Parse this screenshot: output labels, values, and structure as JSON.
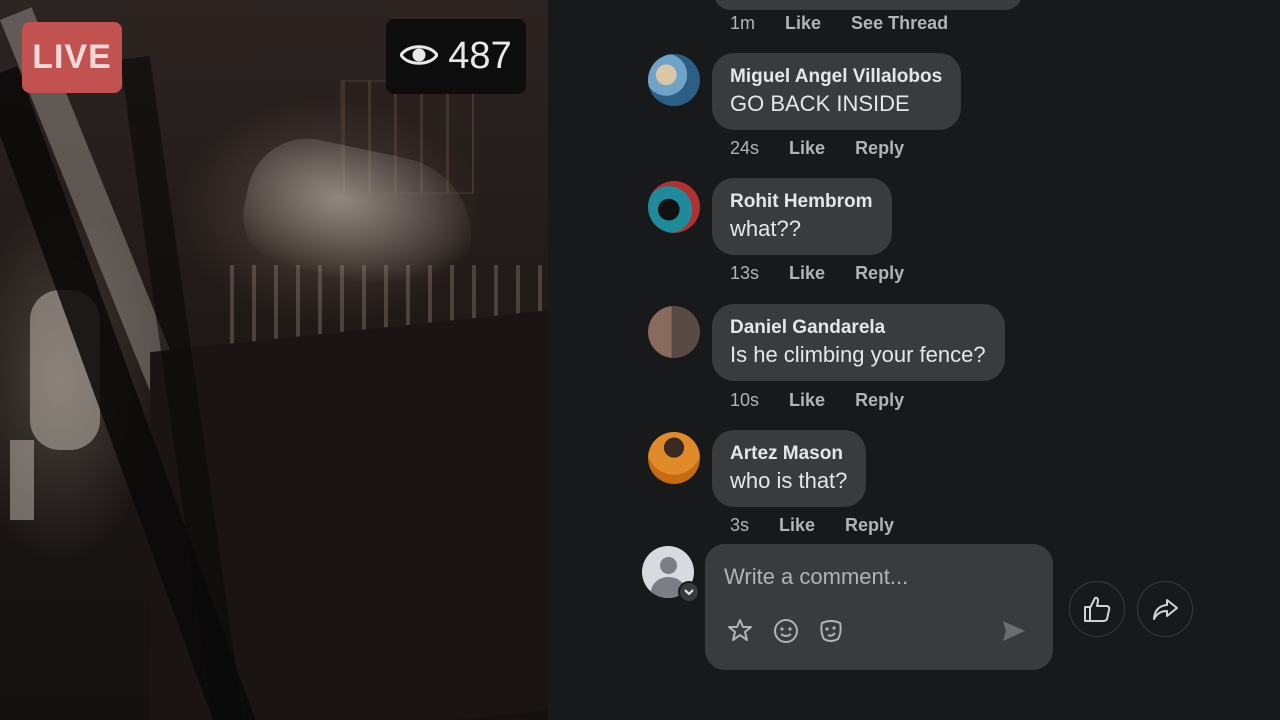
{
  "video": {
    "live_label": "LIVE",
    "viewer_icon": "eye-icon",
    "viewer_count": "487"
  },
  "previous_comment": {
    "time": "1m",
    "like": "Like",
    "action": "See Thread"
  },
  "comments": [
    {
      "name": "Miguel Angel Villalobos",
      "text": "GO BACK INSIDE",
      "time": "24s",
      "like": "Like",
      "reply": "Reply"
    },
    {
      "name": "Rohit Hembrom",
      "text": "what??",
      "time": "13s",
      "like": "Like",
      "reply": "Reply"
    },
    {
      "name": "Daniel Gandarela",
      "text": "Is he climbing your fence?",
      "time": "10s",
      "like": "Like",
      "reply": "Reply"
    },
    {
      "name": "Artez Mason",
      "text": "who is that?",
      "time": "3s",
      "like": "Like",
      "reply": "Reply"
    }
  ],
  "composer": {
    "placeholder": "Write a comment...",
    "tools": [
      "sticker-icon",
      "emoji-icon",
      "avatar-sticker-icon"
    ],
    "send_icon": "send-icon"
  },
  "actions": {
    "like_icon": "thumbs-up-icon",
    "share_icon": "share-icon"
  },
  "colors": {
    "background": "#18191a",
    "bubble": "#3a3b3c",
    "live_badge": "#c2524f",
    "secondary_text": "#b0b3b8"
  }
}
